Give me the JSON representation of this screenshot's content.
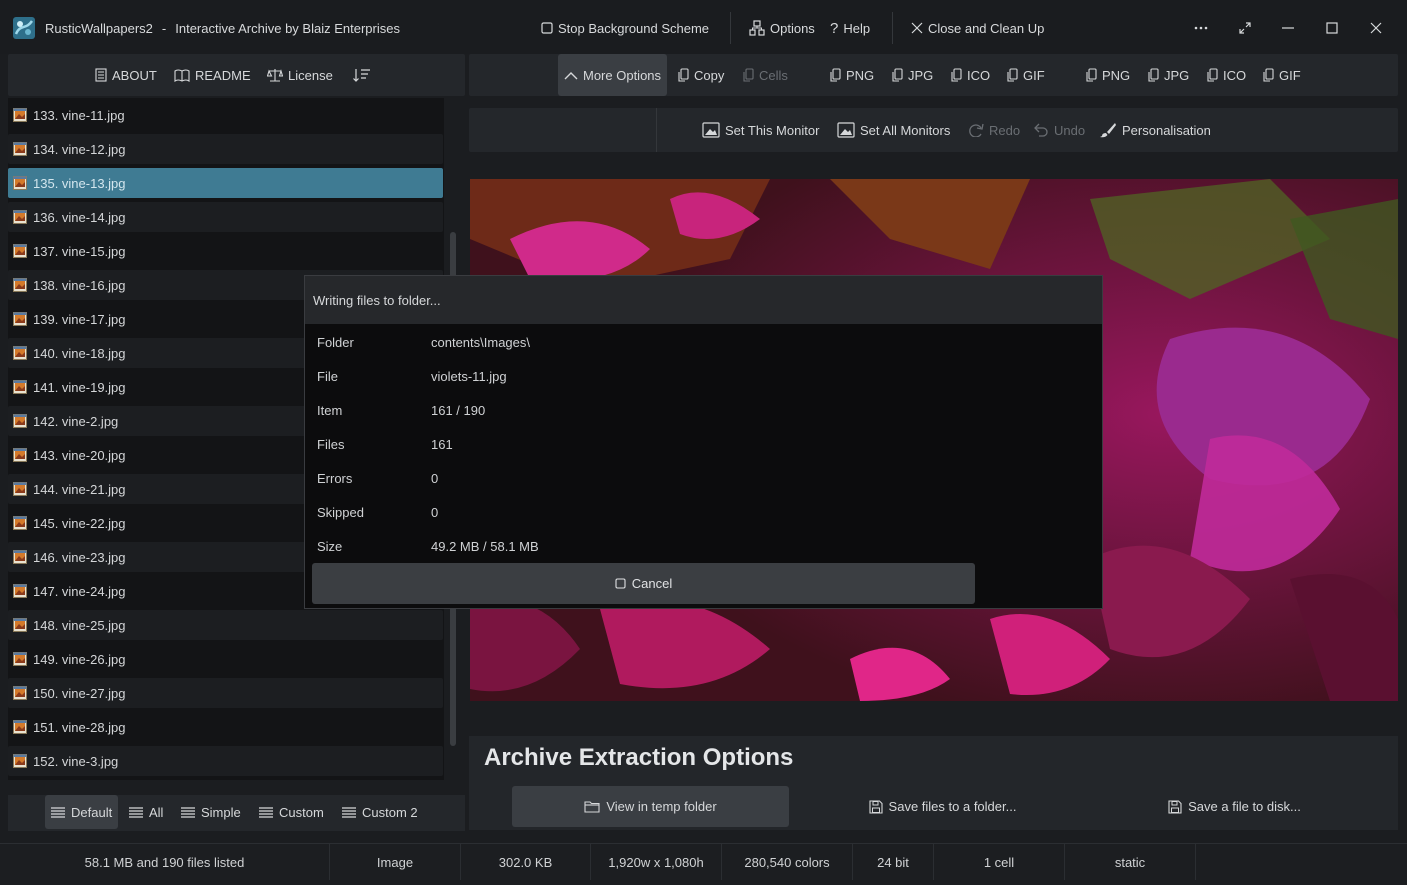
{
  "title": {
    "app_name": "RusticWallpapers2",
    "separator": "-",
    "subtitle": "Interactive Archive by Blaiz Enterprises",
    "stop_bg": "Stop Background Scheme",
    "options": "Options",
    "help": "Help",
    "close_clean": "Close and Clean Up"
  },
  "left_toolbar": {
    "about": "ABOUT",
    "readme": "README",
    "license": "License"
  },
  "right_toolbar": {
    "more_options": "More Options",
    "copy": "Copy",
    "cells": "Cells",
    "group1": [
      "PNG",
      "JPG",
      "ICO",
      "GIF"
    ],
    "group2": [
      "PNG",
      "JPG",
      "ICO",
      "GIF"
    ]
  },
  "secondary_toolbar": {
    "set_this_monitor": "Set This Monitor",
    "set_all_monitors": "Set All Monitors",
    "redo": "Redo",
    "undo": "Undo",
    "personalisation": "Personalisation"
  },
  "files": [
    "133. vine-11.jpg",
    "134. vine-12.jpg",
    "135. vine-13.jpg",
    "136. vine-14.jpg",
    "137. vine-15.jpg",
    "138. vine-16.jpg",
    "139. vine-17.jpg",
    "140. vine-18.jpg",
    "141. vine-19.jpg",
    "142. vine-2.jpg",
    "143. vine-20.jpg",
    "144. vine-21.jpg",
    "145. vine-22.jpg",
    "146. vine-23.jpg",
    "147. vine-24.jpg",
    "148. vine-25.jpg",
    "149. vine-26.jpg",
    "150. vine-27.jpg",
    "151. vine-28.jpg",
    "152. vine-3.jpg"
  ],
  "selected_file": "135. vine-13.jpg",
  "modal": {
    "title": "Writing files to folder...",
    "rows": [
      {
        "key": "Folder",
        "value": "contents\\Images\\"
      },
      {
        "key": "File",
        "value": "violets-11.jpg"
      },
      {
        "key": "Item",
        "value": "161 / 190"
      },
      {
        "key": "Files",
        "value": "161"
      },
      {
        "key": "Errors",
        "value": "0"
      },
      {
        "key": "Skipped",
        "value": "0"
      },
      {
        "key": "Size",
        "value": "49.2 MB / 58.1 MB"
      }
    ],
    "cancel": "Cancel"
  },
  "extraction": {
    "title": "Archive Extraction Options",
    "view_temp": "View in temp folder",
    "save_folder": "Save files to a folder...",
    "save_disk": "Save a file to disk..."
  },
  "view_tabs": [
    "Default",
    "All",
    "Simple",
    "Custom",
    "Custom 2"
  ],
  "active_view_tab": "Default",
  "status": {
    "listed": "58.1 MB and 190 files listed",
    "type": "Image",
    "size": "302.0 KB",
    "dimensions": "1,920w x 1,080h",
    "colors": "280,540 colors",
    "bits": "24 bit",
    "cells": "1 cell",
    "mode": "static"
  },
  "colors": {
    "accent_selected": "#3f7b93",
    "background": "#1b1d20"
  }
}
